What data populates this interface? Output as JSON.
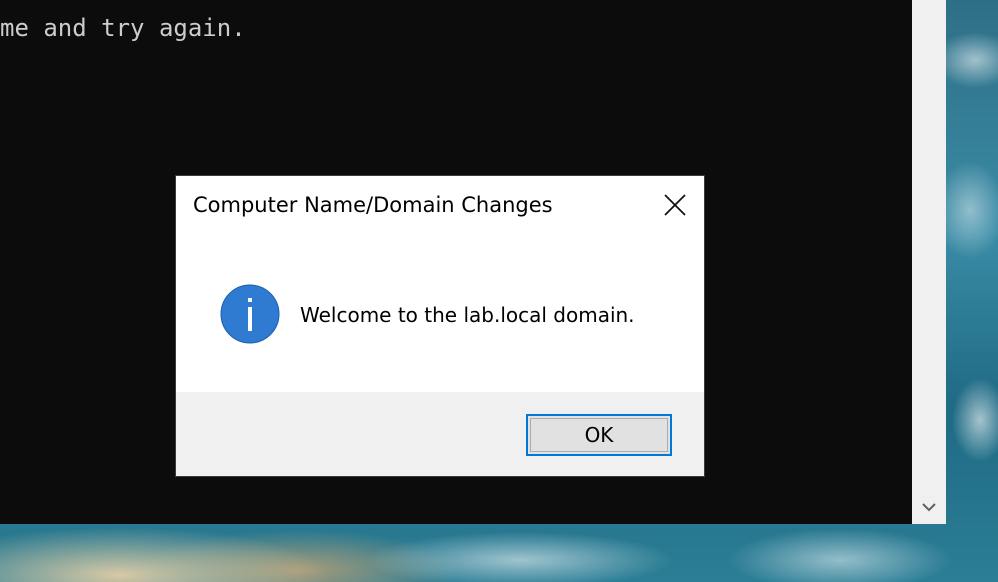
{
  "console": {
    "text": "me and try again."
  },
  "dialog": {
    "title": "Computer Name/Domain Changes",
    "message": "Welcome to the lab.local domain.",
    "ok_label": "OK",
    "icon": "info-icon",
    "close_icon": "close-icon"
  },
  "scrollbar": {
    "down_icon": "chevron-down-icon"
  },
  "colors": {
    "console_bg": "#0c0c0c",
    "console_text": "#cccccc",
    "info_icon_blue": "#2f7bd1",
    "button_focus": "#0078d7",
    "dialog_footer": "#f0f0f0"
  }
}
